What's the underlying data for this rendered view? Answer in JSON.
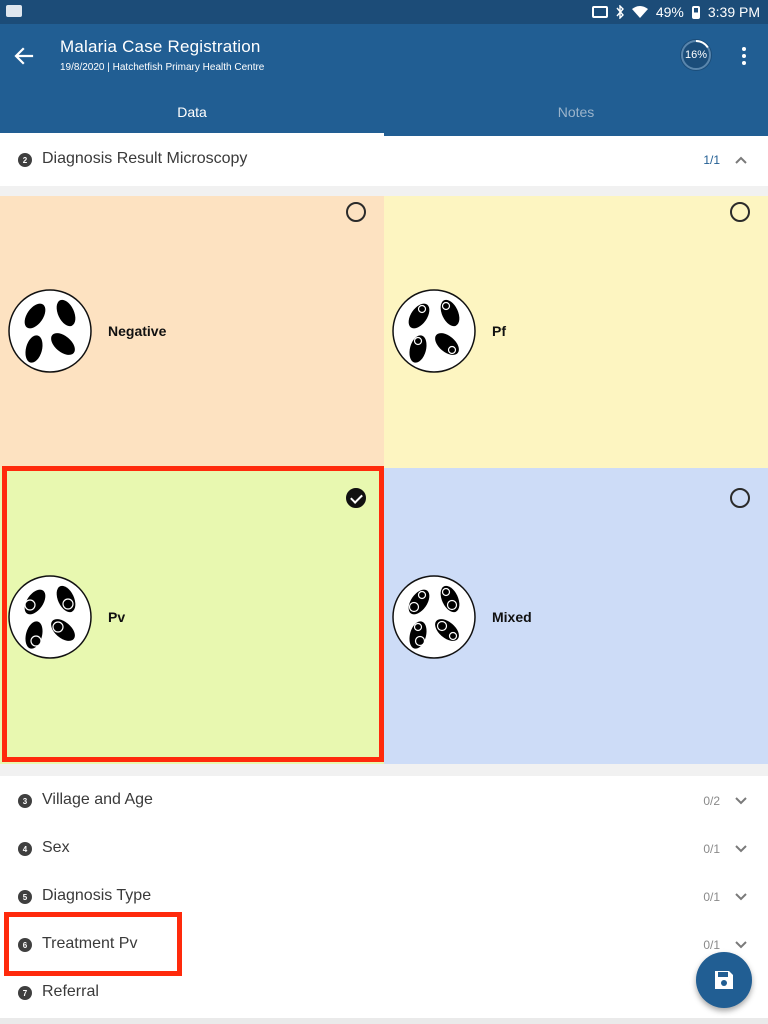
{
  "status_bar": {
    "battery": "49%",
    "time": "3:39 PM"
  },
  "app_bar": {
    "title": "Malaria Case Registration",
    "subtitle": "19/8/2020 | Hatchetfish Primary Health Centre",
    "progress": "16%",
    "progress_fraction": 0.16
  },
  "tabs": [
    {
      "label": "Data",
      "active": true
    },
    {
      "label": "Notes",
      "active": false
    }
  ],
  "sections": [
    {
      "number": "2",
      "title": "Diagnosis Result Microscopy",
      "count": "1/1",
      "expanded": true
    },
    {
      "number": "3",
      "title": "Village and Age",
      "count": "0/2",
      "expanded": false
    },
    {
      "number": "4",
      "title": "Sex",
      "count": "0/1",
      "expanded": false
    },
    {
      "number": "5",
      "title": "Diagnosis Type",
      "count": "0/1",
      "expanded": false
    },
    {
      "number": "6",
      "title": "Treatment Pv",
      "count": "0/1",
      "expanded": false
    },
    {
      "number": "7",
      "title": "Referral",
      "count": "",
      "expanded": false
    }
  ],
  "options": [
    {
      "label": "Negative",
      "selected": false,
      "color": "#fde2c1",
      "icon": "negative-cells-icon"
    },
    {
      "label": "Pf",
      "selected": false,
      "color": "#fdf5c1",
      "icon": "pf-cells-icon"
    },
    {
      "label": "Pv",
      "selected": true,
      "color": "#e8f8b0",
      "icon": "pv-cells-icon"
    },
    {
      "label": "Mixed",
      "selected": false,
      "color": "#cddcf7",
      "icon": "mixed-cells-icon"
    }
  ],
  "colors": {
    "primary": "#215e93",
    "status_bar": "#1c4c78",
    "highlight": "#ff2a0c"
  },
  "fab_icon": "save-icon"
}
